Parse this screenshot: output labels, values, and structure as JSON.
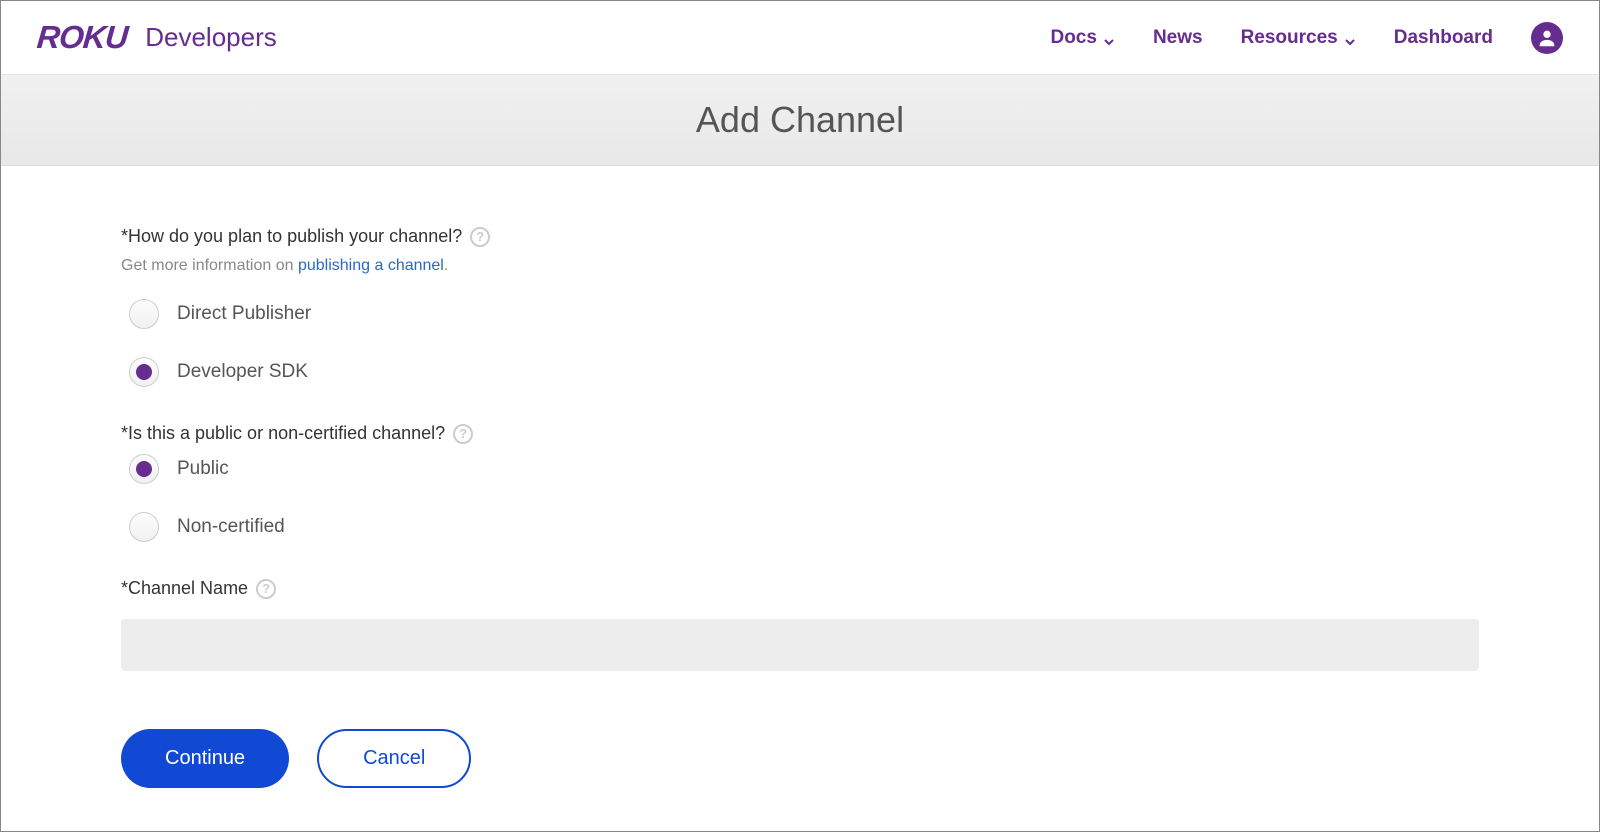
{
  "header": {
    "logo": "ROKU",
    "logo_sub": "Developers",
    "nav": {
      "docs": "Docs",
      "news": "News",
      "resources": "Resources",
      "dashboard": "Dashboard"
    }
  },
  "page": {
    "title": "Add Channel"
  },
  "form": {
    "publish_question": "*How do you plan to publish your channel?",
    "info_prefix": "Get more information on ",
    "info_link": "publishing a channel",
    "info_suffix": ".",
    "publish_options": {
      "direct": "Direct Publisher",
      "sdk": "Developer SDK"
    },
    "publish_selected": "sdk",
    "visibility_question": "*Is this a public or non-certified channel?",
    "visibility_options": {
      "public": "Public",
      "noncertified": "Non-certified"
    },
    "visibility_selected": "public",
    "channel_name_label": "*Channel Name",
    "channel_name_value": ""
  },
  "buttons": {
    "continue": "Continue",
    "cancel": "Cancel"
  }
}
